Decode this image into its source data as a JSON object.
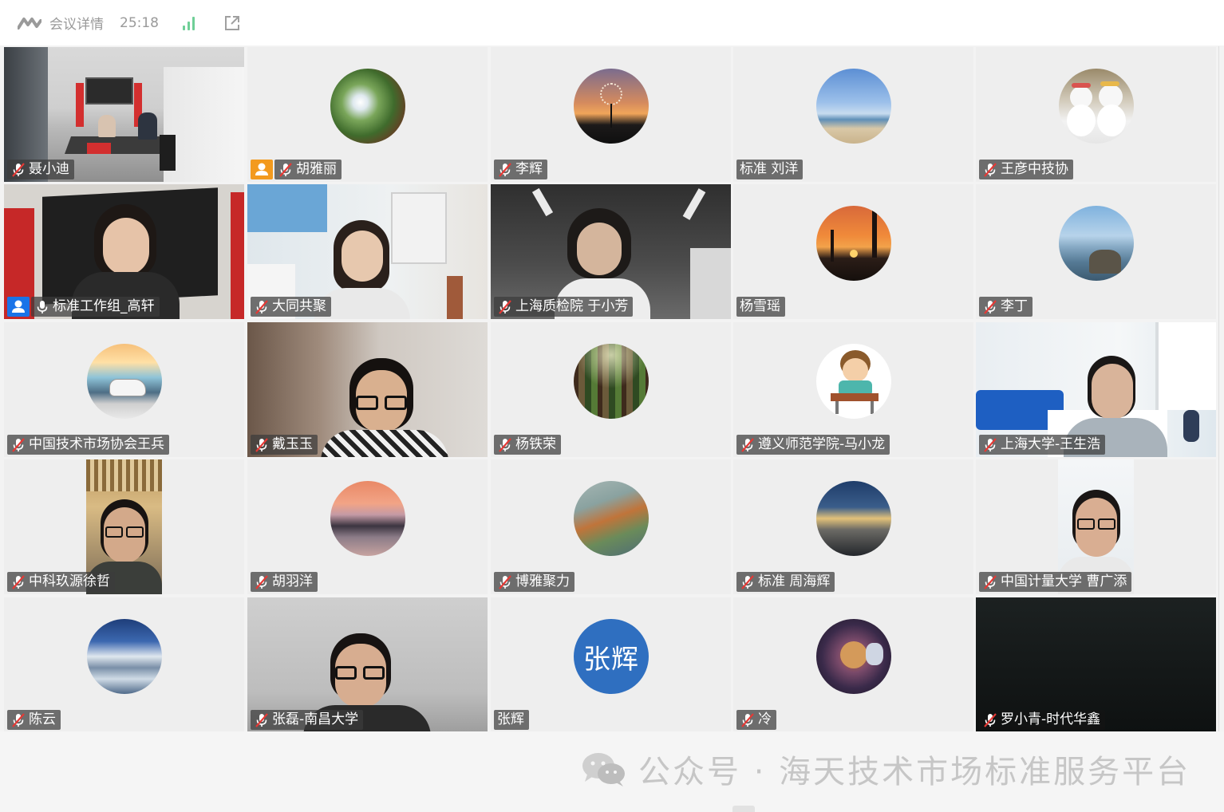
{
  "header": {
    "title": "会议详情",
    "timer": "25:18"
  },
  "colors": {
    "tile_bg": "#eeeeee",
    "name_tag_bg": "#3c3c3c",
    "host_badge": "#f39a1e",
    "cohost_badge": "#1a73e8",
    "signal": "#6fcf97",
    "zhanghui_avatar": "#2f6fc0"
  },
  "participants": [
    {
      "name": "聂小迪",
      "muted": true
    },
    {
      "name": "胡雅丽",
      "muted": true,
      "badge": "host"
    },
    {
      "name": "李辉",
      "muted": true
    },
    {
      "name": "标准 刘洋",
      "muted": false
    },
    {
      "name": "王彦中技协",
      "muted": true
    },
    {
      "name": "标准工作组_高轩",
      "muted": false,
      "badge": "cohost"
    },
    {
      "name": "大同共聚",
      "muted": true
    },
    {
      "name": "上海质检院 于小芳",
      "muted": true
    },
    {
      "name": "杨雪瑶",
      "muted": false
    },
    {
      "name": "李丁",
      "muted": true
    },
    {
      "name": "中国技术市场协会王兵",
      "muted": true
    },
    {
      "name": "戴玉玉",
      "muted": true
    },
    {
      "name": "杨铁荣",
      "muted": true
    },
    {
      "name": "遵义师范学院-马小龙",
      "muted": true
    },
    {
      "name": "上海大学-王生浩",
      "muted": true
    },
    {
      "name": "中科玖源徐哲",
      "muted": true
    },
    {
      "name": "胡羽洋",
      "muted": true
    },
    {
      "name": "博雅聚力",
      "muted": true
    },
    {
      "name": "标准  周海辉",
      "muted": true
    },
    {
      "name": "中国计量大学   曹广添",
      "muted": true
    },
    {
      "name": "陈云",
      "muted": true
    },
    {
      "name": "张磊-南昌大学",
      "muted": true
    },
    {
      "name": "张辉",
      "muted": false
    },
    {
      "name": "冷",
      "muted": true
    },
    {
      "name": "罗小青-时代华鑫",
      "muted": true
    }
  ],
  "zhanghui_avatar_text": "张辉",
  "watermark": {
    "text": "公众号 · 海天技术市场标准服务平台"
  }
}
